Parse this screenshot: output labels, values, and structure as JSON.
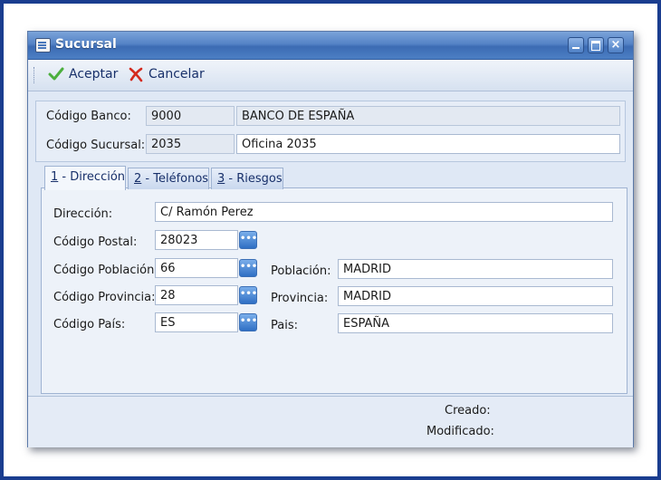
{
  "window": {
    "title": "Sucursal"
  },
  "toolbar": {
    "accept_label": "Aceptar",
    "cancel_label": "Cancelar"
  },
  "header": {
    "banco_label": "Código Banco:",
    "banco_code": "9000",
    "banco_name": "BANCO DE ESPAÑA",
    "sucursal_label": "Código Sucursal:",
    "sucursal_code": "2035",
    "sucursal_name": "Oficina 2035"
  },
  "tabs": [
    {
      "key": "1",
      "rest": " - Dirección"
    },
    {
      "key": "2",
      "rest": " - Teléfonos"
    },
    {
      "key": "3",
      "rest": " - Riesgos"
    }
  ],
  "direccion": {
    "direccion_label": "Dirección:",
    "direccion_value": "C/ Ramón Perez",
    "cp_label": "Código Postal:",
    "cp_value": "28023",
    "cod_poblacion_label": "Código Población:",
    "cod_poblacion_value": "66",
    "poblacion_label": "Población:",
    "poblacion_value": "MADRID",
    "cod_provincia_label": "Código Provincia:",
    "cod_provincia_value": "28",
    "provincia_label": "Provincia:",
    "provincia_value": "MADRID",
    "cod_pais_label": "Código País:",
    "cod_pais_value": "ES",
    "pais_label": "Pais:",
    "pais_value": "ESPAÑA"
  },
  "footer": {
    "creado_label": "Creado:",
    "modificado_label": "Modificado:"
  },
  "icons": {
    "accept": "check-icon",
    "cancel": "cancel-x-icon",
    "lookup": "ellipsis-icon"
  },
  "colors": {
    "frame": "#1a3d8f",
    "titlebar": "#4c7fc4",
    "accept_green": "#4caf3e",
    "cancel_red": "#d42a1e"
  }
}
